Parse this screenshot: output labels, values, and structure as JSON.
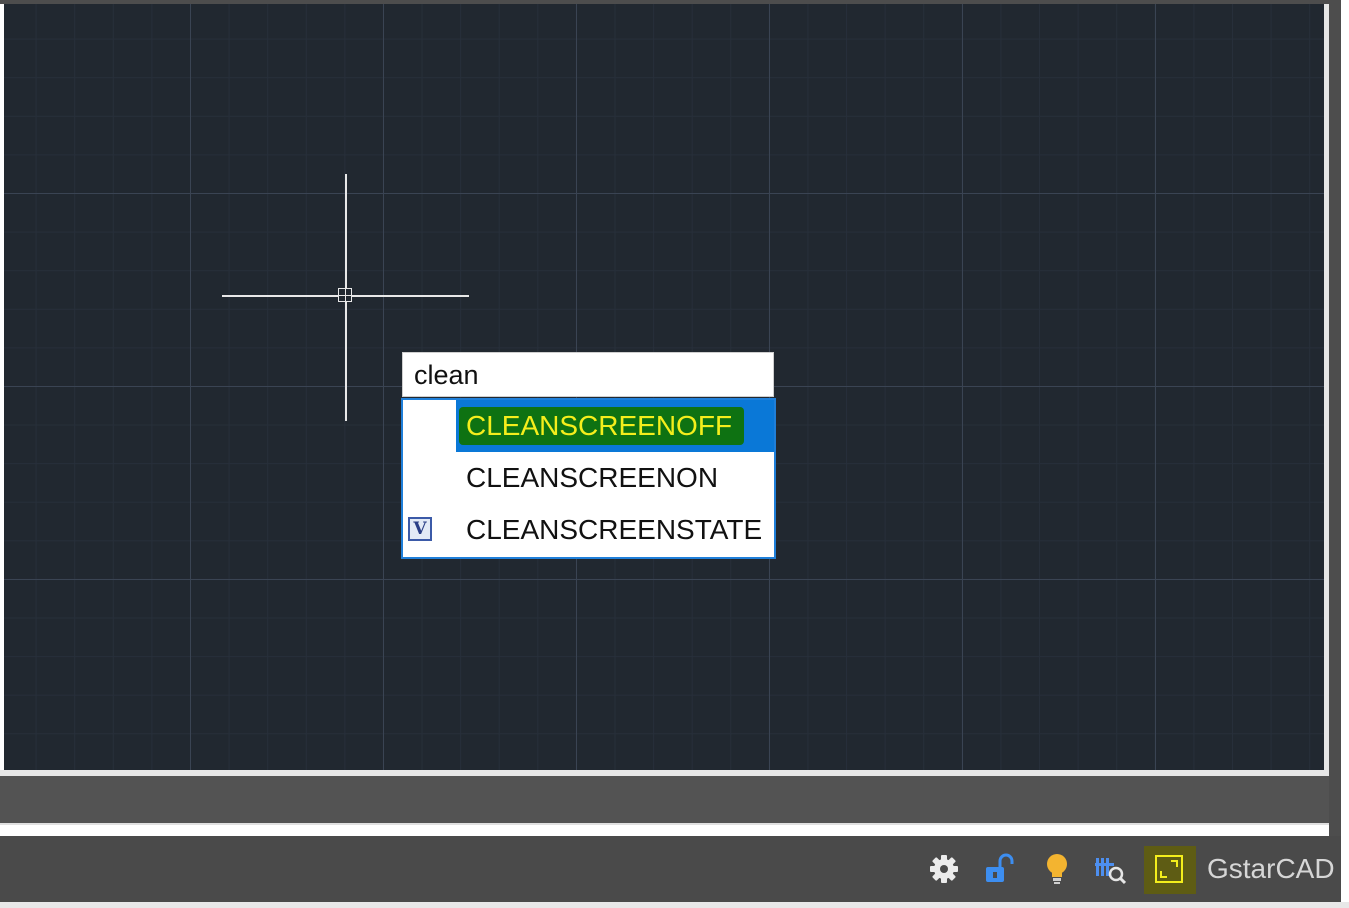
{
  "command_input": {
    "value": "clean"
  },
  "autocomplete": {
    "items": [
      {
        "label": "CLEANSCREENOFF",
        "selected": true,
        "icon": null
      },
      {
        "label": "CLEANSCREENON",
        "selected": false,
        "icon": null
      },
      {
        "label": "CLEANSCREENSTATE",
        "selected": false,
        "icon": "system-variable-icon",
        "icon_text": "V"
      }
    ]
  },
  "status_bar": {
    "icons": [
      "gear-icon",
      "lock-icon",
      "bulb-icon",
      "isolate-objects-icon",
      "clean-screen-icon"
    ],
    "brand": "GstarCAD"
  },
  "colors": {
    "canvas_bg": "#212830",
    "selection_blue": "#0a78d7",
    "highlight_green": "#0e7212",
    "highlight_yellow": "#f4ee1c"
  }
}
